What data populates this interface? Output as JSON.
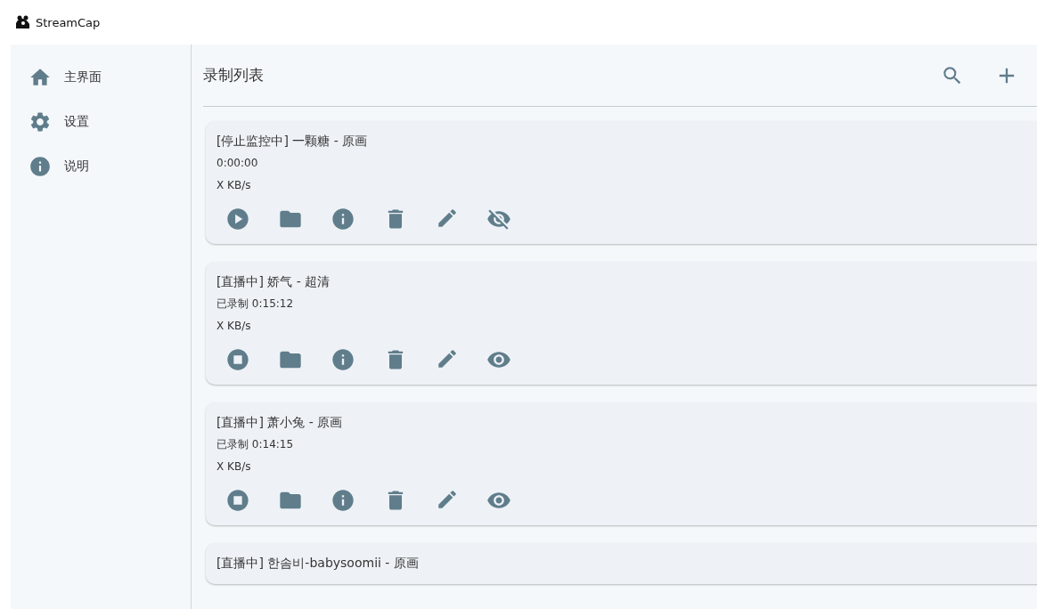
{
  "window": {
    "title": "StreamCap"
  },
  "sidebar": {
    "items": [
      {
        "label": "主界面"
      },
      {
        "label": "设置"
      },
      {
        "label": "说明"
      }
    ]
  },
  "header": {
    "title": "录制列表"
  },
  "recordings": [
    {
      "title": "[停止监控中] 一颗糖 - 原画",
      "duration": "0:00:00",
      "speed": "X KB/s",
      "recording": false,
      "hidden": true
    },
    {
      "title": "[直播中] 娇气 - 超清",
      "duration": "已录制 0:15:12",
      "speed": "X KB/s",
      "recording": true,
      "hidden": false
    },
    {
      "title": "[直播中] 萧小兔 - 原画",
      "duration": "已录制 0:14:15",
      "speed": "X KB/s",
      "recording": true,
      "hidden": false
    },
    {
      "title": "[直播中] 한솜비-babysoomii - 原画"
    }
  ]
}
